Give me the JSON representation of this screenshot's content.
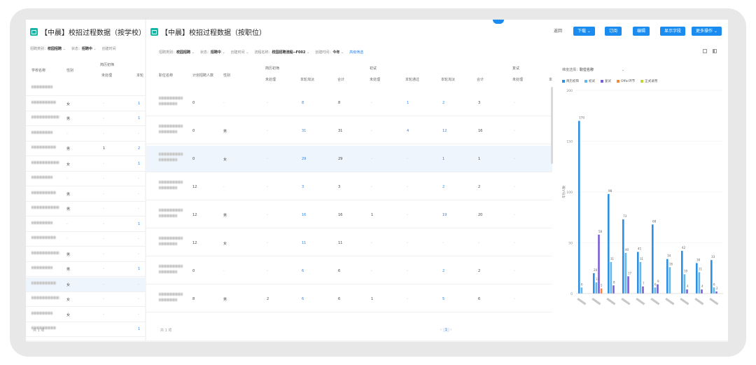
{
  "left_panel": {
    "title": "【中晨】校招过程数据（按学校）",
    "filters": [
      {
        "label": "招聘类别：",
        "value": "校园招聘",
        "arrow": "⌄"
      },
      {
        "label": "状态：",
        "value": "招聘中",
        "arrow": "⌄"
      },
      {
        "label": "创建时间",
        "value": "",
        "arrow": ""
      }
    ],
    "headers": {
      "school": "学校名称",
      "gender": "性别",
      "resume_group": "简历初筛",
      "pending": "未处理",
      "more": "本轮"
    },
    "rows": [
      {
        "gender": "",
        "pending": "",
        "other": ""
      },
      {
        "gender": "女",
        "pending": "-",
        "other": "1"
      },
      {
        "gender": "男",
        "pending": "-",
        "other": "1"
      },
      {
        "gender": "-",
        "pending": "-",
        "other": "-"
      },
      {
        "gender": "男",
        "pending": "1",
        "other": "2"
      },
      {
        "gender": "女",
        "pending": "-",
        "other": "1"
      },
      {
        "gender": "-",
        "pending": "-",
        "other": "-"
      },
      {
        "gender": "男",
        "pending": "-",
        "other": "-"
      },
      {
        "gender": "男",
        "pending": "-",
        "other": "-"
      },
      {
        "gender": "-",
        "pending": "-",
        "other": "1"
      },
      {
        "gender": "-",
        "pending": "-",
        "other": "-"
      },
      {
        "gender": "男",
        "pending": "-",
        "other": "-"
      },
      {
        "gender": "男",
        "pending": "-",
        "other": "1"
      },
      {
        "gender": "女",
        "pending": "-",
        "other": "-"
      },
      {
        "gender": "女",
        "pending": "-",
        "other": "-"
      },
      {
        "gender": "女",
        "pending": "-",
        "other": "-"
      },
      {
        "gender": "",
        "pending": "",
        "other": "1"
      }
    ]
  },
  "main_panel": {
    "title": "【中晨】校招过程数据（按职位）",
    "actions": {
      "back": "返回",
      "download": "下载",
      "subscribe": "订阅",
      "edit": "编辑",
      "show_fields": "显示字段",
      "more": "更多操作"
    },
    "filters": [
      {
        "label": "招聘类别：",
        "value": "校园招聘",
        "arrow": "⌄"
      },
      {
        "label": "状态：",
        "value": "招聘中",
        "arrow": "⌄"
      },
      {
        "label": "创建时间",
        "value": "",
        "arrow": "⌄"
      },
      {
        "label": "流程名称：",
        "value": "校园招聘流程--F002",
        "arrow": "⌄"
      },
      {
        "label": "创建时间：",
        "value": "今年",
        "arrow": "⌄"
      }
    ],
    "advanced_filter": "高级筛选",
    "headers": {
      "position": "职位名称",
      "planned": "计划招聘人数",
      "gender": "性别",
      "resume_group": "简历初筛",
      "interview_group": "初试",
      "retest_group": "复试",
      "pending": "未处理",
      "round_eliminated": "本轮淘汰",
      "total": "合计",
      "round_passed": "本轮通过",
      "more": "本"
    },
    "rows": [
      {
        "planned": "0",
        "gender": "-",
        "rs_pending": "-",
        "rs_elim": "8",
        "rs_total": "8",
        "iv_pending": "-",
        "iv_pass": "1",
        "iv_elim": "2",
        "iv_total": "3",
        "rt_pending": "-"
      },
      {
        "planned": "0",
        "gender": "男",
        "rs_pending": "-",
        "rs_elim": "31",
        "rs_total": "31",
        "iv_pending": "-",
        "iv_pass": "4",
        "iv_elim": "12",
        "iv_total": "16",
        "rt_pending": "-"
      },
      {
        "planned": "0",
        "gender": "女",
        "rs_pending": "-",
        "rs_elim": "29",
        "rs_total": "29",
        "iv_pending": "-",
        "iv_pass": "-",
        "iv_elim": "1",
        "iv_total": "1",
        "rt_pending": "-"
      },
      {
        "planned": "12",
        "gender": "-",
        "rs_pending": "-",
        "rs_elim": "3",
        "rs_total": "3",
        "iv_pending": "-",
        "iv_pass": "-",
        "iv_elim": "2",
        "iv_total": "2",
        "rt_pending": "-"
      },
      {
        "planned": "12",
        "gender": "男",
        "rs_pending": "-",
        "rs_elim": "16",
        "rs_total": "16",
        "iv_pending": "1",
        "iv_pass": "-",
        "iv_elim": "19",
        "iv_total": "20",
        "rt_pending": "-"
      },
      {
        "planned": "12",
        "gender": "女",
        "rs_pending": "-",
        "rs_elim": "11",
        "rs_total": "11",
        "iv_pending": "-",
        "iv_pass": "-",
        "iv_elim": "-",
        "iv_total": "-",
        "rt_pending": "-"
      },
      {
        "planned": "0",
        "gender": "-",
        "rs_pending": "-",
        "rs_elim": "6",
        "rs_total": "6",
        "iv_pending": "-",
        "iv_pass": "-",
        "iv_elim": "2",
        "iv_total": "2",
        "rt_pending": "-"
      },
      {
        "planned": "8",
        "gender": "男",
        "rs_pending": "2",
        "rs_elim": "6",
        "rs_total": "6",
        "iv_pending": "1",
        "iv_pass": "-",
        "iv_elim": "5",
        "iv_total": "6",
        "rt_pending": "-"
      }
    ]
  },
  "chart_panel": {
    "dimension_label": "维度选择：",
    "dimension_value": "职位名称",
    "dimension_arrow": "⌄",
    "ylabel": "年份人数",
    "legend": [
      {
        "name": "简历初筛",
        "color": "#2f8fe0"
      },
      {
        "name": "初试",
        "color": "#62b8ef"
      },
      {
        "name": "复试",
        "color": "#7a5fd6"
      },
      {
        "name": "Offer环节",
        "color": "#f08a3c"
      },
      {
        "name": "正式录用",
        "color": "#c4d43c"
      }
    ]
  },
  "chart_data": {
    "type": "bar",
    "ylim": [
      0,
      200
    ],
    "yticks": [
      "0",
      "50",
      "100",
      "150",
      "200"
    ],
    "series_colors": [
      "#2f8fe0",
      "#62b8ef",
      "#7a5fd6",
      "#f08a3c",
      "#c4d43c"
    ],
    "bars": [
      {
        "main": 170,
        "second": 6
      },
      {
        "main": 20,
        "second": 11,
        "third": 58,
        "fourth": 5
      },
      {
        "main": 98,
        "second": 31,
        "third": 8
      },
      {
        "main": 73,
        "second": 40,
        "third": 17
      },
      {
        "main": 41,
        "second": 31,
        "third": 7
      },
      {
        "main": 68,
        "second": 6,
        "third": 9
      },
      {
        "main": 34,
        "second": 26
      },
      {
        "main": 42,
        "second": 19,
        "third": 4
      },
      {
        "main": 30,
        "second": 21,
        "third": 4
      },
      {
        "main": 33,
        "second": 6,
        "third": 2
      }
    ],
    "labels": [
      "170",
      "58",
      "73",
      "68",
      "41",
      "40",
      "42",
      "34",
      "30",
      "33",
      "31",
      "26",
      "21",
      "19",
      "17",
      "11",
      "9",
      "8",
      "7",
      "6",
      "5",
      "4",
      "2"
    ]
  },
  "pagination": {
    "hint_left": "共 1 项",
    "page": "1"
  }
}
